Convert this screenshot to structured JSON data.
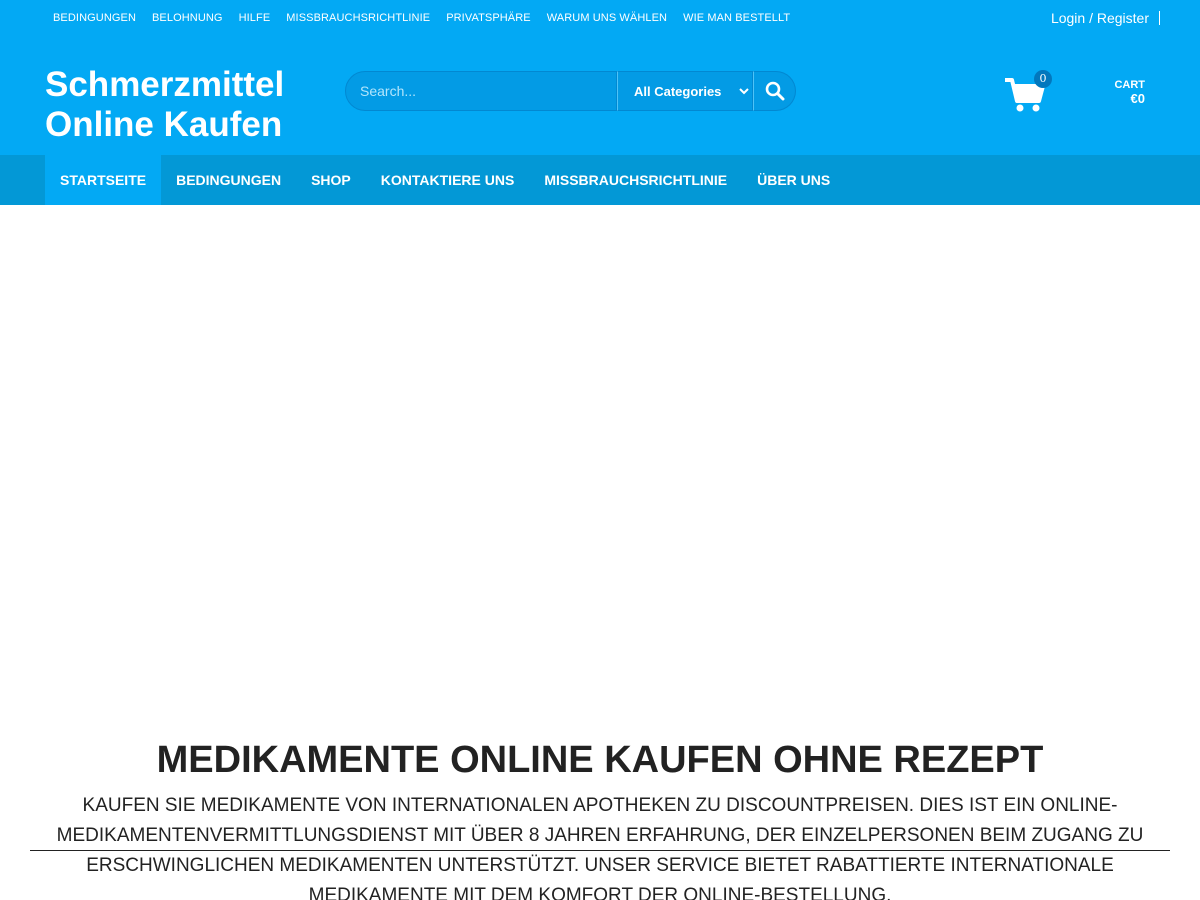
{
  "topbar": {
    "links": [
      "BEDINGUNGEN",
      "BELOHNUNG",
      "HILFE",
      "MISSBRAUCHSRICHTLINIE",
      "PRIVATSPHÄRE",
      "WARUM UNS WÄHLEN",
      "WIE MAN BESTELLT"
    ],
    "login_label": "Login / Register"
  },
  "header": {
    "logo_line1": "Schmerzmittel",
    "logo_line2": "Online Kaufen",
    "search_placeholder": "Search...",
    "category_selected": "All Categories",
    "search_icon": "search-icon",
    "cart_icon": "shopping-cart-icon",
    "cart_count": "0",
    "cart_label": "CART",
    "cart_amount": "€0"
  },
  "nav": {
    "items": [
      "STARTSEITE",
      "BEDINGUNGEN",
      "SHOP",
      "KONTAKTIERE UNS",
      "MISSBRAUCHSRICHTLINIE",
      "ÜBER UNS"
    ],
    "active_index": 0
  },
  "main": {
    "headline": "MEDIKAMENTE ONLINE KAUFEN OHNE REZEPT",
    "intro": "KAUFEN SIE MEDIKAMENTE VON INTERNATIONALEN APOTHEKEN ZU DISCOUNTPREISEN. DIES IST EIN ONLINE-MEDIKAMENTENVERMITTLUNGSDIENST MIT ÜBER 8 JAHREN ERFAHRUNG, DER EINZELPERSONEN BEIM ZUGANG ZU ERSCHWINGLICHEN MEDIKAMENTEN UNTERSTÜTZT. UNSER SERVICE BIETET RABATTIERTE INTERNATIONALE MEDIKAMENTE MIT DEM KOMFORT DER ONLINE-BESTELLUNG."
  },
  "colors": {
    "brand_blue": "#03a9f4",
    "nav_blue": "#0398d6",
    "text_dark": "#222222"
  }
}
